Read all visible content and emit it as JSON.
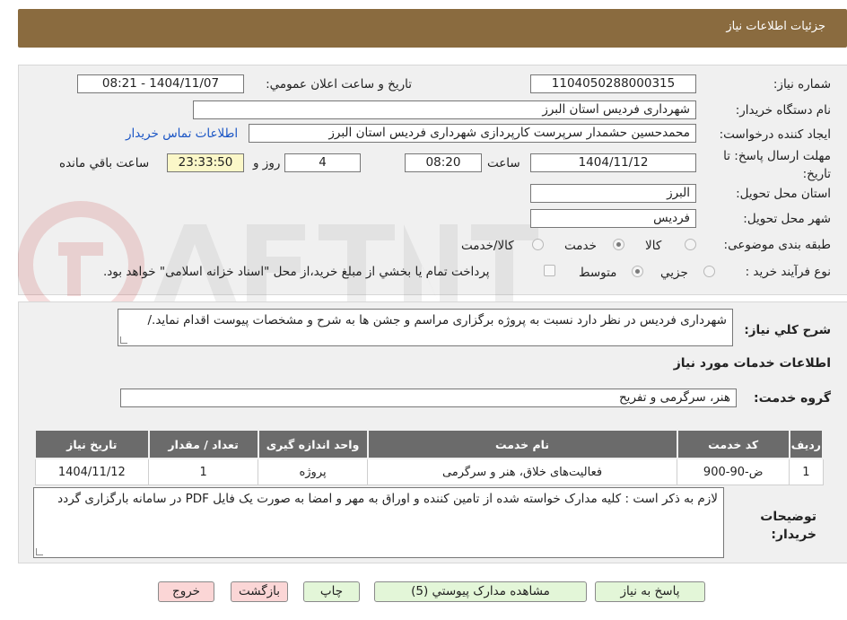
{
  "header": {
    "title": "جزئیات اطلاعات نیاز"
  },
  "form": {
    "need_number": {
      "label": "شماره نیاز:",
      "value": "1104050288000315"
    },
    "announce": {
      "label": "تاریخ و ساعت اعلان عمومي:",
      "value": "1404/11/07 - 08:21"
    },
    "buyer_org": {
      "label": "نام دستگاه خريدار:",
      "value": "شهرداری فردیس استان البرز"
    },
    "requester": {
      "label": "ايجاد كننده درخواست:",
      "value": "محمدحسین حشمدار سرپرست کارپردازی شهرداری فردیس استان البرز",
      "contact_link": "اطلاعات تماس خريدار"
    },
    "deadline": {
      "label": "مهلت ارسال پاسخ: تا تاريخ:",
      "date": "1404/11/12",
      "time_label": "ساعت",
      "time": "08:20",
      "days": "4",
      "days_label": "روز و",
      "remaining": "23:33:50",
      "remaining_label": "ساعت باقي مانده"
    },
    "province": {
      "label": "استان محل تحويل:",
      "value": "البرز"
    },
    "city": {
      "label": "شهر محل تحويل:",
      "value": "فردیس"
    },
    "category": {
      "label": "طبقه بندی موضوعی:",
      "options": [
        "کالا",
        "خدمت",
        "کالا/خدمت"
      ],
      "selected": "خدمت"
    },
    "purchase_type": {
      "label": "نوع فرآیند خرید :",
      "options": [
        "جزيي",
        "متوسط"
      ],
      "selected": "متوسط",
      "payment_note": "پرداخت تمام يا بخشي از مبلغ خريد،از محل \"اسناد خزانه اسلامی\" خواهد بود."
    }
  },
  "summary": {
    "label": "شرح كلي نياز:",
    "text": "شهرداری فردیس در نظر دارد نسبت به پروژه برگزاری مراسم و جشن ها به شرح و مشخصات پیوست اقدام نماید./"
  },
  "services": {
    "section_title": "اطلاعات خدمات مورد نياز",
    "group_label": "گروه خدمت:",
    "group_value": "هنر، سرگرمی و تفریح",
    "columns": [
      "رديف",
      "كد خدمت",
      "نام خدمت",
      "واحد اندازه گيری",
      "تعداد / مقدار",
      "تاريخ نياز"
    ],
    "rows": [
      [
        "1",
        "ض-90-900",
        "فعالیت‌های خلاق، هنر و سرگرمی",
        "پروژه",
        "1",
        "1404/11/12"
      ]
    ]
  },
  "buyer_notes": {
    "label": "توضيحات خريدار:",
    "text": "لازم به ذکر است : کلیه مدارک خواسته شده از تامین کننده و اوراق به مهر و امضا به صورت یک فایل PDF در سامانه بارگزاری گردد"
  },
  "buttons": {
    "reply": "پاسخ به نياز",
    "attachments": "مشاهده مدارک پيوستي (5)",
    "print": "چاپ",
    "back": "بازگشت",
    "exit": "خروج"
  },
  "colors": {
    "header_bg": "#8a6b3f",
    "panel_bg": "#f0f0f0",
    "table_header_bg": "#6b6b6b",
    "button_green": "#e3f6d8",
    "button_red": "#fbd6d6",
    "timer_bg": "#fbf7c8",
    "link": "#1a55c5"
  }
}
